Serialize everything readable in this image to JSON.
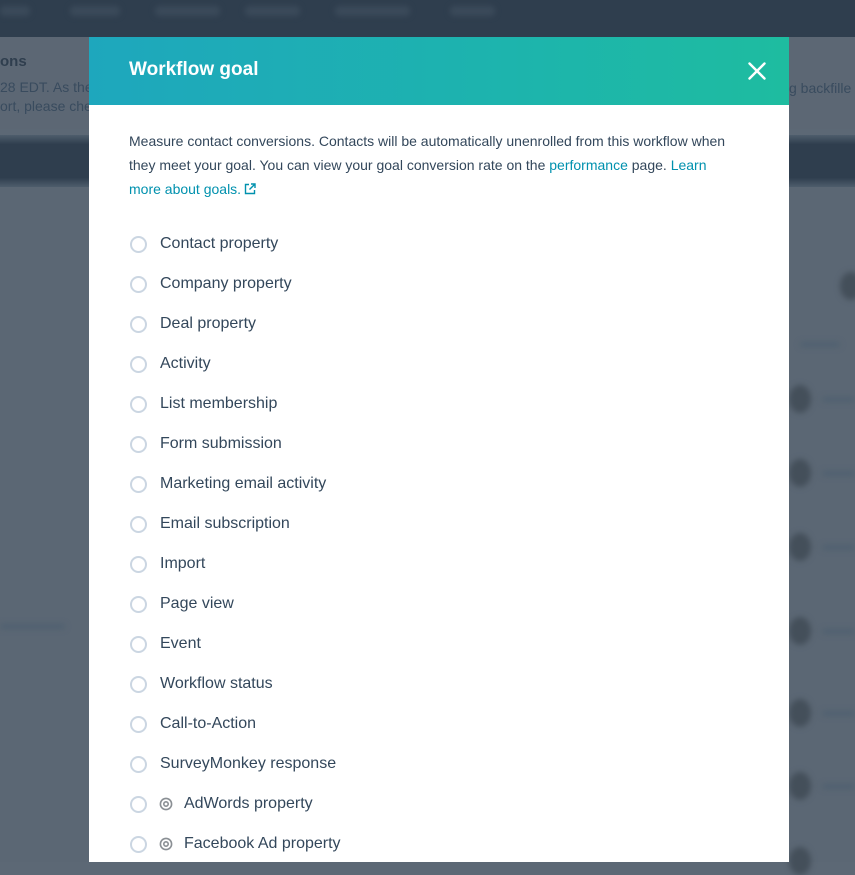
{
  "background": {
    "banner_title_fragment": "ons",
    "banner_line1_fragment": "28 EDT. As the",
    "banner_line2_fragment": "ort, please che",
    "banner_right_fragment": "g backfille"
  },
  "modal": {
    "title": "Workflow goal",
    "close_icon": "close-icon",
    "intro": {
      "text_before_link": "Measure contact conversions. Contacts will be automatically unenrolled from this workflow when they meet your goal. You can view your goal conversion rate on the ",
      "performance_link": "performance",
      "text_after_link": " page. ",
      "learn_more_link": "Learn more about goals.",
      "learn_more_icon": "external-link-icon"
    },
    "options": [
      {
        "label": "Contact property",
        "selected": false
      },
      {
        "label": "Company property",
        "selected": false
      },
      {
        "label": "Deal property",
        "selected": false
      },
      {
        "label": "Activity",
        "selected": false
      },
      {
        "label": "List membership",
        "selected": false
      },
      {
        "label": "Form submission",
        "selected": false
      },
      {
        "label": "Marketing email activity",
        "selected": false
      },
      {
        "label": "Email subscription",
        "selected": false
      },
      {
        "label": "Import",
        "selected": false
      },
      {
        "label": "Page view",
        "selected": false
      },
      {
        "label": "Event",
        "selected": false
      },
      {
        "label": "Workflow status",
        "selected": false
      },
      {
        "label": "Call-to-Action",
        "selected": false
      },
      {
        "label": "SurveyMonkey response",
        "selected": false
      },
      {
        "label": "AdWords property",
        "selected": false,
        "icon": "target-icon"
      },
      {
        "label": "Facebook Ad property",
        "selected": false,
        "icon": "target-icon"
      }
    ]
  },
  "colors": {
    "header_gradient_start": "#1ea7bd",
    "header_gradient_end": "#1ebca0",
    "link": "#0091ae",
    "text": "#33475b",
    "radio_border": "#cbd6e2"
  }
}
